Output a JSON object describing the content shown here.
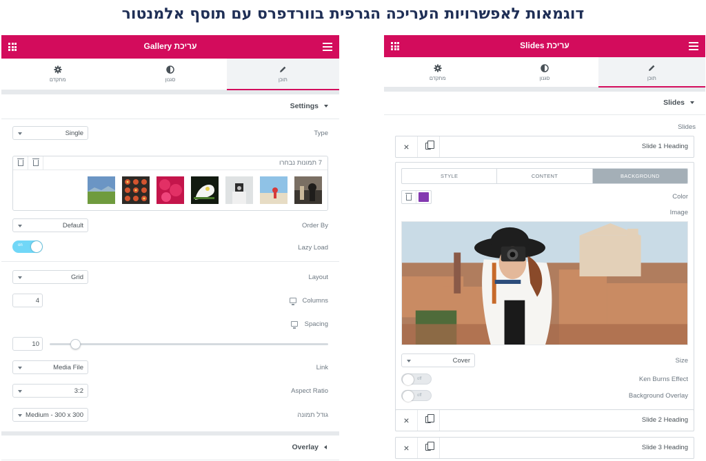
{
  "page_title": "דוגמאות לאפשרויות העריכה הגרפית בוורדפרס עם תוסף אלמנטור",
  "left_panel": {
    "header_title": "עריכת Gallery",
    "tabs": [
      {
        "label": "מתקדם",
        "icon": "gear-icon"
      },
      {
        "label": "סגנון",
        "icon": "half-circle-icon"
      },
      {
        "label": "תוכן",
        "icon": "pencil-icon"
      }
    ],
    "section_settings": "Settings",
    "type_label": "Type",
    "type_value": "Single",
    "gallery_selected": "7 תמונות נבחרו",
    "order_by_label": "Order By",
    "order_by_value": "Default",
    "lazy_load_label": "Lazy Load",
    "lazy_load_toggle": "on",
    "lazy_load_enabled": true,
    "layout_label": "Layout",
    "layout_value": "Grid",
    "columns_label": "Columns",
    "columns_value": "4",
    "spacing_label": "Spacing",
    "spacing_value": "10",
    "link_label": "Link",
    "link_value": "Media File",
    "aspect_ratio_label": "Aspect Ratio",
    "aspect_ratio_value": "3:2",
    "image_size_label": "גודל תמונה",
    "image_size_value": "Medium - 300 x 300",
    "section_overlay": "Overlay"
  },
  "right_panel": {
    "header_title": "עריכת Slides",
    "tabs": [
      {
        "label": "מתקדם",
        "icon": "gear-icon"
      },
      {
        "label": "סגנון",
        "icon": "half-circle-icon"
      },
      {
        "label": "תוכן",
        "icon": "pencil-icon"
      }
    ],
    "section_slides": "Slides",
    "slides_label": "Slides",
    "slide1": "Slide 1 Heading",
    "slide2": "Slide 2 Heading",
    "slide3": "Slide 3 Heading",
    "inner_tabs": [
      "STYLE",
      "CONTENT",
      "BACKGROUND"
    ],
    "color_label": "Color",
    "color_value": "#8339b0",
    "image_label": "Image",
    "size_label": "Size",
    "size_value": "Cover",
    "ken_burns_label": "Ken Burns Effect",
    "ken_burns_toggle": "off",
    "bg_overlay_label": "Background Overlay",
    "bg_overlay_toggle": "off"
  },
  "colors": {
    "brand": "#d30c5c",
    "title": "#1f2f56",
    "toggle_on": "#71d7f7",
    "inactive_tab": "#a4afb7"
  }
}
